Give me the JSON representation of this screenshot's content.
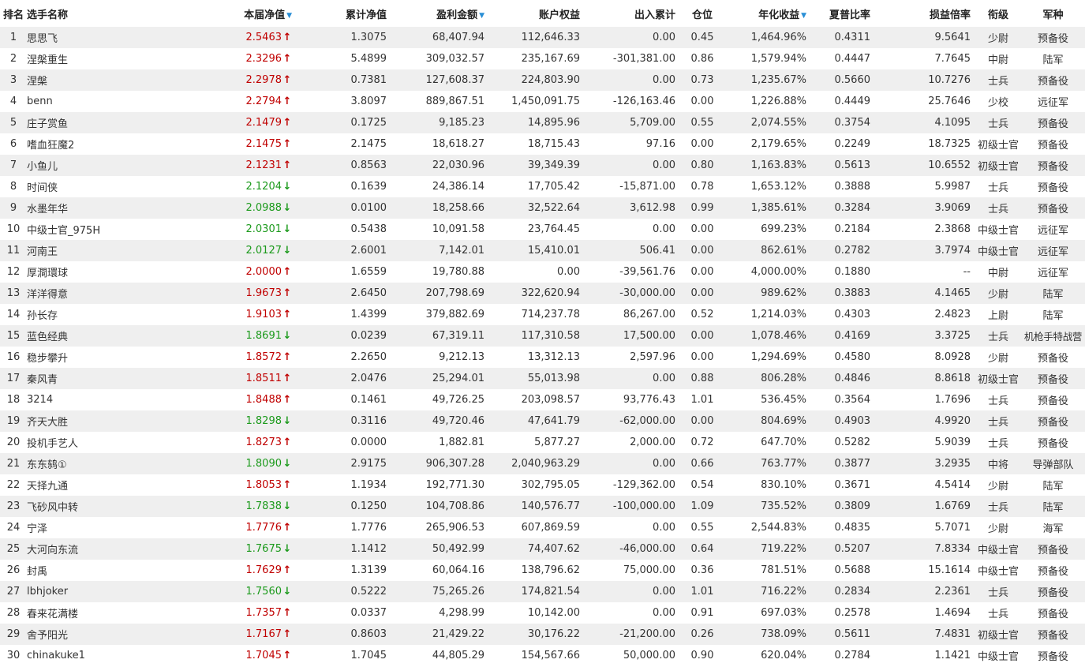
{
  "headers": {
    "rank": "排名",
    "name": "选手名称",
    "nav": "本届净值",
    "cum_nav": "累计净值",
    "profit": "盈利金额",
    "equity": "账户权益",
    "flow": "出入累计",
    "position": "仓位",
    "annual": "年化收益",
    "sharpe": "夏普比率",
    "pl_ratio": "损益倍率",
    "title": "衔级",
    "branch": "军种"
  },
  "sort_indicator": "▼",
  "icons": {
    "up": "arrow-up-icon",
    "down": "arrow-down-icon"
  },
  "colors": {
    "up": "#c00000",
    "down": "#1c9a1c",
    "sort": "#2a8fd6",
    "row_alt": "#efefef"
  },
  "rows": [
    {
      "rank": "1",
      "name": "思思飞",
      "nav": "2.5463",
      "dir": "up",
      "cum_nav": "1.3075",
      "profit": "68,407.94",
      "equity": "112,646.33",
      "flow": "0.00",
      "position": "0.45",
      "annual": "1,464.96%",
      "sharpe": "0.4311",
      "pl_ratio": "9.5641",
      "title": "少尉",
      "branch": "预备役"
    },
    {
      "rank": "2",
      "name": "涅槃重生",
      "nav": "2.3296",
      "dir": "up",
      "cum_nav": "5.4899",
      "profit": "309,032.57",
      "equity": "235,167.69",
      "flow": "-301,381.00",
      "position": "0.86",
      "annual": "1,579.94%",
      "sharpe": "0.4447",
      "pl_ratio": "7.7645",
      "title": "中尉",
      "branch": "陆军"
    },
    {
      "rank": "3",
      "name": "涅槃",
      "nav": "2.2978",
      "dir": "up",
      "cum_nav": "0.7381",
      "profit": "127,608.37",
      "equity": "224,803.90",
      "flow": "0.00",
      "position": "0.73",
      "annual": "1,235.67%",
      "sharpe": "0.5660",
      "pl_ratio": "10.7276",
      "title": "士兵",
      "branch": "预备役"
    },
    {
      "rank": "4",
      "name": "benn",
      "nav": "2.2794",
      "dir": "up",
      "cum_nav": "3.8097",
      "profit": "889,867.51",
      "equity": "1,450,091.75",
      "flow": "-126,163.46",
      "position": "0.00",
      "annual": "1,226.88%",
      "sharpe": "0.4449",
      "pl_ratio": "25.7646",
      "title": "少校",
      "branch": "远征军"
    },
    {
      "rank": "5",
      "name": "庄子赏鱼",
      "nav": "2.1479",
      "dir": "up",
      "cum_nav": "0.1725",
      "profit": "9,185.23",
      "equity": "14,895.96",
      "flow": "5,709.00",
      "position": "0.55",
      "annual": "2,074.55%",
      "sharpe": "0.3754",
      "pl_ratio": "4.1095",
      "title": "士兵",
      "branch": "预备役"
    },
    {
      "rank": "6",
      "name": "嗜血狂魔2",
      "nav": "2.1475",
      "dir": "up",
      "cum_nav": "2.1475",
      "profit": "18,618.27",
      "equity": "18,715.43",
      "flow": "97.16",
      "position": "0.00",
      "annual": "2,179.65%",
      "sharpe": "0.2249",
      "pl_ratio": "18.7325",
      "title": "初级士官",
      "branch": "预备役"
    },
    {
      "rank": "7",
      "name": "小鱼儿",
      "nav": "2.1231",
      "dir": "up",
      "cum_nav": "0.8563",
      "profit": "22,030.96",
      "equity": "39,349.39",
      "flow": "0.00",
      "position": "0.80",
      "annual": "1,163.83%",
      "sharpe": "0.5613",
      "pl_ratio": "10.6552",
      "title": "初级士官",
      "branch": "预备役"
    },
    {
      "rank": "8",
      "name": "时间侠",
      "nav": "2.1204",
      "dir": "down",
      "cum_nav": "0.1639",
      "profit": "24,386.14",
      "equity": "17,705.42",
      "flow": "-15,871.00",
      "position": "0.78",
      "annual": "1,653.12%",
      "sharpe": "0.3888",
      "pl_ratio": "5.9987",
      "title": "士兵",
      "branch": "预备役"
    },
    {
      "rank": "9",
      "name": "水墨年华",
      "nav": "2.0988",
      "dir": "down",
      "cum_nav": "0.0100",
      "profit": "18,258.66",
      "equity": "32,522.64",
      "flow": "3,612.98",
      "position": "0.99",
      "annual": "1,385.61%",
      "sharpe": "0.3284",
      "pl_ratio": "3.9069",
      "title": "士兵",
      "branch": "预备役"
    },
    {
      "rank": "10",
      "name": "中级士官_975H",
      "nav": "2.0301",
      "dir": "down",
      "cum_nav": "0.5438",
      "profit": "10,091.58",
      "equity": "23,764.45",
      "flow": "0.00",
      "position": "0.00",
      "annual": "699.23%",
      "sharpe": "0.2184",
      "pl_ratio": "2.3868",
      "title": "中级士官",
      "branch": "远征军"
    },
    {
      "rank": "11",
      "name": "河南王",
      "nav": "2.0127",
      "dir": "down",
      "cum_nav": "2.6001",
      "profit": "7,142.01",
      "equity": "15,410.01",
      "flow": "506.41",
      "position": "0.00",
      "annual": "862.61%",
      "sharpe": "0.2782",
      "pl_ratio": "3.7974",
      "title": "中级士官",
      "branch": "远征军"
    },
    {
      "rank": "12",
      "name": "厚澗環球",
      "nav": "2.0000",
      "dir": "up",
      "cum_nav": "1.6559",
      "profit": "19,780.88",
      "equity": "0.00",
      "flow": "-39,561.76",
      "position": "0.00",
      "annual": "4,000.00%",
      "sharpe": "0.1880",
      "pl_ratio": "--",
      "title": "中尉",
      "branch": "远征军"
    },
    {
      "rank": "13",
      "name": "洋洋得意",
      "nav": "1.9673",
      "dir": "up",
      "cum_nav": "2.6450",
      "profit": "207,798.69",
      "equity": "322,620.94",
      "flow": "-30,000.00",
      "position": "0.00",
      "annual": "989.62%",
      "sharpe": "0.3883",
      "pl_ratio": "4.1465",
      "title": "少尉",
      "branch": "陆军"
    },
    {
      "rank": "14",
      "name": "孙长存",
      "nav": "1.9103",
      "dir": "up",
      "cum_nav": "1.4399",
      "profit": "379,882.69",
      "equity": "714,237.78",
      "flow": "86,267.00",
      "position": "0.52",
      "annual": "1,214.03%",
      "sharpe": "0.4303",
      "pl_ratio": "2.4823",
      "title": "上尉",
      "branch": "陆军"
    },
    {
      "rank": "15",
      "name": "蓝色经典",
      "nav": "1.8691",
      "dir": "down",
      "cum_nav": "0.0239",
      "profit": "67,319.11",
      "equity": "117,310.58",
      "flow": "17,500.00",
      "position": "0.00",
      "annual": "1,078.46%",
      "sharpe": "0.4169",
      "pl_ratio": "3.3725",
      "title": "士兵",
      "branch": "机枪手特战营"
    },
    {
      "rank": "16",
      "name": "稳步攀升",
      "nav": "1.8572",
      "dir": "up",
      "cum_nav": "2.2650",
      "profit": "9,212.13",
      "equity": "13,312.13",
      "flow": "2,597.96",
      "position": "0.00",
      "annual": "1,294.69%",
      "sharpe": "0.4580",
      "pl_ratio": "8.0928",
      "title": "少尉",
      "branch": "预备役"
    },
    {
      "rank": "17",
      "name": "秦风青",
      "nav": "1.8511",
      "dir": "up",
      "cum_nav": "2.0476",
      "profit": "25,294.01",
      "equity": "55,013.98",
      "flow": "0.00",
      "position": "0.88",
      "annual": "806.28%",
      "sharpe": "0.4846",
      "pl_ratio": "8.8618",
      "title": "初级士官",
      "branch": "预备役"
    },
    {
      "rank": "18",
      "name": "3214",
      "nav": "1.8488",
      "dir": "up",
      "cum_nav": "0.1461",
      "profit": "49,726.25",
      "equity": "203,098.57",
      "flow": "93,776.43",
      "position": "1.01",
      "annual": "536.45%",
      "sharpe": "0.3564",
      "pl_ratio": "1.7696",
      "title": "士兵",
      "branch": "预备役"
    },
    {
      "rank": "19",
      "name": "齐天大胜",
      "nav": "1.8298",
      "dir": "down",
      "cum_nav": "0.3116",
      "profit": "49,720.46",
      "equity": "47,641.79",
      "flow": "-62,000.00",
      "position": "0.00",
      "annual": "804.69%",
      "sharpe": "0.4903",
      "pl_ratio": "4.9920",
      "title": "士兵",
      "branch": "预备役"
    },
    {
      "rank": "20",
      "name": "投机手艺人",
      "nav": "1.8273",
      "dir": "up",
      "cum_nav": "0.0000",
      "profit": "1,882.81",
      "equity": "5,877.27",
      "flow": "2,000.00",
      "position": "0.72",
      "annual": "647.70%",
      "sharpe": "0.5282",
      "pl_ratio": "5.9039",
      "title": "士兵",
      "branch": "预备役"
    },
    {
      "rank": "21",
      "name": "东东鸫①",
      "nav": "1.8090",
      "dir": "down",
      "cum_nav": "2.9175",
      "profit": "906,307.28",
      "equity": "2,040,963.29",
      "flow": "0.00",
      "position": "0.66",
      "annual": "763.77%",
      "sharpe": "0.3877",
      "pl_ratio": "3.2935",
      "title": "中将",
      "branch": "导弹部队"
    },
    {
      "rank": "22",
      "name": "天择九通",
      "nav": "1.8053",
      "dir": "up",
      "cum_nav": "1.1934",
      "profit": "192,771.30",
      "equity": "302,795.05",
      "flow": "-129,362.00",
      "position": "0.54",
      "annual": "830.10%",
      "sharpe": "0.3671",
      "pl_ratio": "4.5414",
      "title": "少尉",
      "branch": "陆军"
    },
    {
      "rank": "23",
      "name": "飞砂风中转",
      "nav": "1.7838",
      "dir": "down",
      "cum_nav": "0.1250",
      "profit": "104,708.86",
      "equity": "140,576.77",
      "flow": "-100,000.00",
      "position": "1.09",
      "annual": "735.52%",
      "sharpe": "0.3809",
      "pl_ratio": "1.6769",
      "title": "士兵",
      "branch": "陆军"
    },
    {
      "rank": "24",
      "name": "宁泽",
      "nav": "1.7776",
      "dir": "up",
      "cum_nav": "1.7776",
      "profit": "265,906.53",
      "equity": "607,869.59",
      "flow": "0.00",
      "position": "0.55",
      "annual": "2,544.83%",
      "sharpe": "0.4835",
      "pl_ratio": "5.7071",
      "title": "少尉",
      "branch": "海军"
    },
    {
      "rank": "25",
      "name": "大河向东流",
      "nav": "1.7675",
      "dir": "down",
      "cum_nav": "1.1412",
      "profit": "50,492.99",
      "equity": "74,407.62",
      "flow": "-46,000.00",
      "position": "0.64",
      "annual": "719.22%",
      "sharpe": "0.5207",
      "pl_ratio": "7.8334",
      "title": "中级士官",
      "branch": "预备役"
    },
    {
      "rank": "26",
      "name": "封禹",
      "nav": "1.7629",
      "dir": "up",
      "cum_nav": "1.3139",
      "profit": "60,064.16",
      "equity": "138,796.62",
      "flow": "75,000.00",
      "position": "0.36",
      "annual": "781.51%",
      "sharpe": "0.5688",
      "pl_ratio": "15.1614",
      "title": "中级士官",
      "branch": "预备役"
    },
    {
      "rank": "27",
      "name": "lbhjoker",
      "nav": "1.7560",
      "dir": "down",
      "cum_nav": "0.5222",
      "profit": "75,265.26",
      "equity": "174,821.54",
      "flow": "0.00",
      "position": "1.01",
      "annual": "716.22%",
      "sharpe": "0.2834",
      "pl_ratio": "2.2361",
      "title": "士兵",
      "branch": "预备役"
    },
    {
      "rank": "28",
      "name": "春来花满楼",
      "nav": "1.7357",
      "dir": "up",
      "cum_nav": "0.0337",
      "profit": "4,298.99",
      "equity": "10,142.00",
      "flow": "0.00",
      "position": "0.91",
      "annual": "697.03%",
      "sharpe": "0.2578",
      "pl_ratio": "1.4694",
      "title": "士兵",
      "branch": "预备役"
    },
    {
      "rank": "29",
      "name": "舍予阳光",
      "nav": "1.7167",
      "dir": "up",
      "cum_nav": "0.8603",
      "profit": "21,429.22",
      "equity": "30,176.22",
      "flow": "-21,200.00",
      "position": "0.26",
      "annual": "738.09%",
      "sharpe": "0.5611",
      "pl_ratio": "7.4831",
      "title": "初级士官",
      "branch": "预备役"
    },
    {
      "rank": "30",
      "name": "chinakuke1",
      "nav": "1.7045",
      "dir": "up",
      "cum_nav": "1.7045",
      "profit": "44,805.29",
      "equity": "154,567.66",
      "flow": "50,000.00",
      "position": "0.90",
      "annual": "620.04%",
      "sharpe": "0.2784",
      "pl_ratio": "1.1421",
      "title": "中级士官",
      "branch": "预备役"
    }
  ]
}
